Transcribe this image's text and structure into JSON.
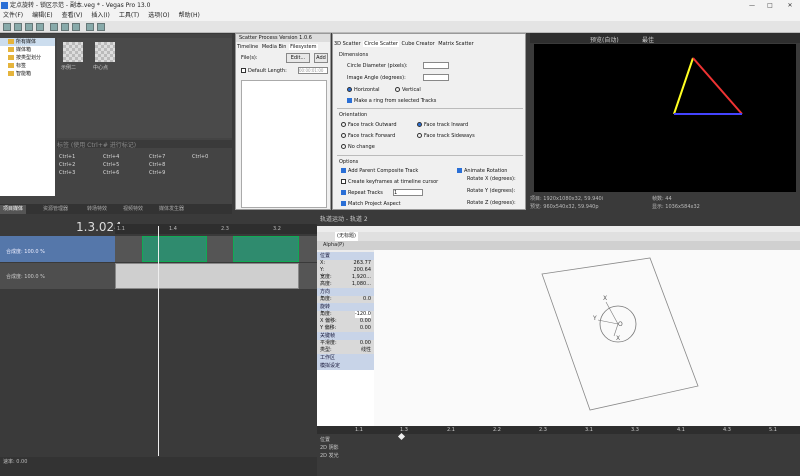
{
  "window": {
    "title": "定点旋转 - 锁区示范 - 副本.veg * - Vegas Pro 13.0"
  },
  "menu": [
    "文件(F)",
    "编辑(E)",
    "查看(V)",
    "插入(I)",
    "工具(T)",
    "选项(O)",
    "帮助(H)"
  ],
  "explorer": {
    "tree": [
      "所有媒体",
      "媒体箱",
      "按类型划分",
      "标签",
      "智能箱"
    ],
    "thumbs": [
      "示例二",
      "中心点"
    ],
    "subheader": "标签 (使用 Ctrl+# 进行标记)"
  },
  "shortcuts": [
    "Ctrl+1",
    "Ctrl+4",
    "Ctrl+7",
    "Ctrl+0",
    "Ctrl+2",
    "Ctrl+5",
    "Ctrl+8",
    "Ctrl+3",
    "Ctrl+6",
    "Ctrl+9"
  ],
  "bottom_tabs": [
    "项目媒体",
    "资源管理器",
    "转场特效",
    "视频特效",
    "媒体发生器"
  ],
  "plugin": {
    "brand": "Scatter",
    "title": "Process Version 1.0.6",
    "tabs": [
      "Timeline",
      "Media Bin",
      "Filesystem"
    ],
    "file_label": "File(s):",
    "edit_btn": "Edit...",
    "add_btn": "Add",
    "default_length": "Default Length:",
    "length_value": "00:00:01:00"
  },
  "scatter": {
    "tabs": [
      "3D Scatter",
      "Circle Scatter",
      "Cube Creator",
      "Matrix Scatter"
    ],
    "dimensions": "Dimensions",
    "circle_diameter": "Circle Diameter (pixels):",
    "image_angle": "Image Angle (degrees):",
    "horizontal": "Horizontal",
    "vertical": "Vertical",
    "make_ring": "Make a ring from selected Tracks",
    "orientation": "Orientation",
    "face_outward": "Face track Outward",
    "face_inward": "Face track Inward",
    "face_forward": "Face track Forward",
    "face_sideways": "Face track Sideways",
    "no_change": "No change",
    "options": "Options",
    "add_parent": "Add Parent Composite Track",
    "animate_rotation": "Animate Rotation",
    "create_keyframes": "Create keyframes at timeline cursor",
    "rotate_x": "Rotate X (degrees):",
    "repeat_tracks": "Repeat Tracks",
    "repeat_count": "1",
    "rotate_y": "Rotate Y (degrees):",
    "match_aspect": "Match Project Aspect",
    "rotate_z": "Rotate Z (degrees):"
  },
  "preview": {
    "toolbar": "预览(自动)",
    "toolbar2": "最佳",
    "project": "项目: 1920x1080x32, 59.940i",
    "preview_res": "预览: 960x540x32, 59.940p",
    "frame": "帧数: 44",
    "display": "显示: 1036x584x32"
  },
  "timeline": {
    "timecode": "1.3.024",
    "ruler": [
      "1.1",
      "1.4",
      "2.3",
      "3.2"
    ],
    "track1_label": "合成度: 100.0 %",
    "track2_label": "合成度: 100.0 %",
    "rate": "速率: 0.00"
  },
  "event_pan": {
    "title": "轨道运动 - 轨道 2",
    "preset": "(无标题)",
    "alpha": "Alpha(P)",
    "sections": [
      "位置",
      "方向",
      "旋转",
      "关键帧",
      "工作区",
      "模拟设定"
    ],
    "position": [
      [
        "X:",
        "263.77"
      ],
      [
        "Y:",
        "200.64"
      ],
      [
        "宽度:",
        "1,920..."
      ],
      [
        "高度:",
        "1,080..."
      ]
    ],
    "direction": [
      [
        "角度:",
        "0.0"
      ]
    ],
    "rotation": [
      [
        "角度:",
        "-120.0"
      ],
      [
        "X 偏移:",
        "0.00"
      ],
      [
        "Y 偏移:",
        "0.00"
      ]
    ],
    "keyframe": [
      [
        "平滑度:",
        "0.00"
      ],
      [
        "类型:",
        "线性"
      ]
    ],
    "ruler": [
      "1.1",
      "1.3",
      "2.1",
      "2.2",
      "2.3",
      "3.1",
      "3.3",
      "4.1",
      "4.3",
      "5.1",
      "5.3"
    ],
    "kf_rows": [
      "位置",
      "2D 阴影",
      "2D 发光"
    ]
  },
  "colors": {
    "accent": "#2a6fd6",
    "clip_video": "#2f8b6e",
    "track_selected": "#5577aa"
  }
}
